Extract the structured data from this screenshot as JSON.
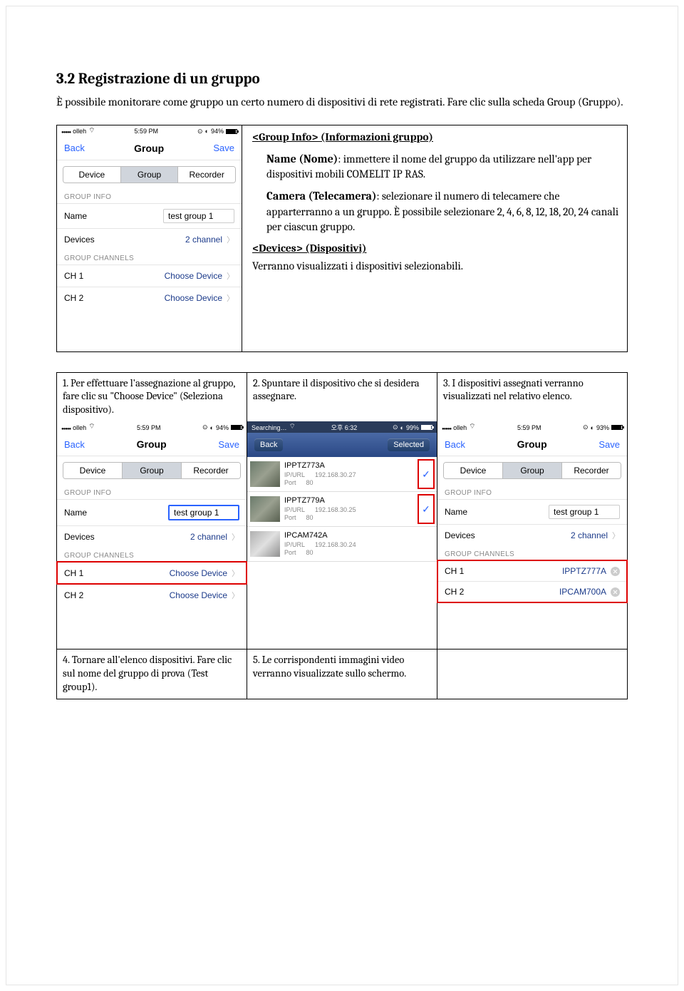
{
  "section": {
    "title": "3.2 Registrazione di un gruppo",
    "intro": "È possibile monitorare come gruppo un certo numero di dispositivi di rete registrati. Fare clic sulla scheda Group (Gruppo)."
  },
  "top": {
    "groupInfoHead": "<Group Info> (Informazioni gruppo)",
    "nameLabel": "Name (Nome)",
    "nameDesc": ": immettere il nome del gruppo da utilizzare nell'app per dispositivi mobili COMELIT IP RAS.",
    "cameraLabel": "Camera (Telecamera)",
    "cameraDesc": ": selezionare il numero di telecamere che apparterranno a un gruppo. È possibile selezionare 2, 4, 6, 8, 12, 18, 20, 24 canali per ciascun gruppo.",
    "devicesHead": "<Devices> (Dispositivi)",
    "devicesDesc": "Verranno visualizzati i dispositivi selezionabili.",
    "phone": {
      "statusLeft": "olleh",
      "time": "5:59 PM",
      "batteryTxt": "94%",
      "back": "Back",
      "title": "Group",
      "save": "Save",
      "tabs": [
        "Device",
        "Group",
        "Recorder"
      ],
      "sectInfo": "GROUP INFO",
      "rowNameLabel": "Name",
      "rowNameValue": "test group 1",
      "rowDevicesLabel": "Devices",
      "rowDevicesValue": "2 channel",
      "sectChannels": "GROUP CHANNELS",
      "ch1Label": "CH 1",
      "ch2Label": "CH 2",
      "chooseDevice": "Choose Device"
    }
  },
  "steps": {
    "s1": {
      "caption": "1. Per effettuare l'assegnazione al gruppo, fare clic su \"Choose Device\" (Seleziona dispositivo).",
      "phone": {
        "statusLeft": "olleh",
        "time": "5:59 PM",
        "batteryTxt": "94%",
        "back": "Back",
        "title": "Group",
        "save": "Save",
        "tabs": [
          "Device",
          "Group",
          "Recorder"
        ],
        "sectInfo": "GROUP INFO",
        "rowNameLabel": "Name",
        "rowNameValue": "test group 1",
        "rowDevicesLabel": "Devices",
        "rowDevicesValue": "2 channel",
        "sectChannels": "GROUP CHANNELS",
        "ch1Label": "CH 1",
        "ch2Label": "CH 2",
        "chooseDevice": "Choose Device"
      }
    },
    "s2": {
      "caption": "2. Spuntare il dispositivo che si desidera assegnare.",
      "phone": {
        "statusLeft": "Searching…",
        "time": "오후 6:32",
        "batteryTxt": "99%",
        "back": "Back",
        "save": "Selected",
        "devices": [
          {
            "name": "IPPTZ773A",
            "ipLabel": "IP/URL",
            "ip": "192.168.30.27",
            "portLabel": "Port",
            "port": "80",
            "checked": true
          },
          {
            "name": "IPPTZ779A",
            "ipLabel": "IP/URL",
            "ip": "192.168.30.25",
            "portLabel": "Port",
            "port": "80",
            "checked": true
          },
          {
            "name": "IPCAM742A",
            "ipLabel": "IP/URL",
            "ip": "192.168.30.24",
            "portLabel": "Port",
            "port": "80",
            "checked": false
          }
        ]
      }
    },
    "s3": {
      "caption": "3. I dispositivi assegnati verranno visualizzati nel relativo elenco.",
      "phone": {
        "statusLeft": "olleh",
        "time": "5:59 PM",
        "batteryTxt": "93%",
        "back": "Back",
        "title": "Group",
        "save": "Save",
        "tabs": [
          "Device",
          "Group",
          "Recorder"
        ],
        "sectInfo": "GROUP INFO",
        "rowNameLabel": "Name",
        "rowNameValue": "test group 1",
        "rowDevicesLabel": "Devices",
        "rowDevicesValue": "2 channel",
        "sectChannels": "GROUP CHANNELS",
        "ch1Label": "CH 1",
        "ch1Value": "IPPTZ777A",
        "ch2Label": "CH 2",
        "ch2Value": "IPCAM700A"
      }
    },
    "s4": {
      "caption": "4. Tornare all'elenco dispositivi. Fare clic sul nome del gruppo di prova (Test group1)."
    },
    "s5": {
      "caption": "5. Le corrispondenti immagini video verranno visualizzate sullo schermo."
    }
  }
}
